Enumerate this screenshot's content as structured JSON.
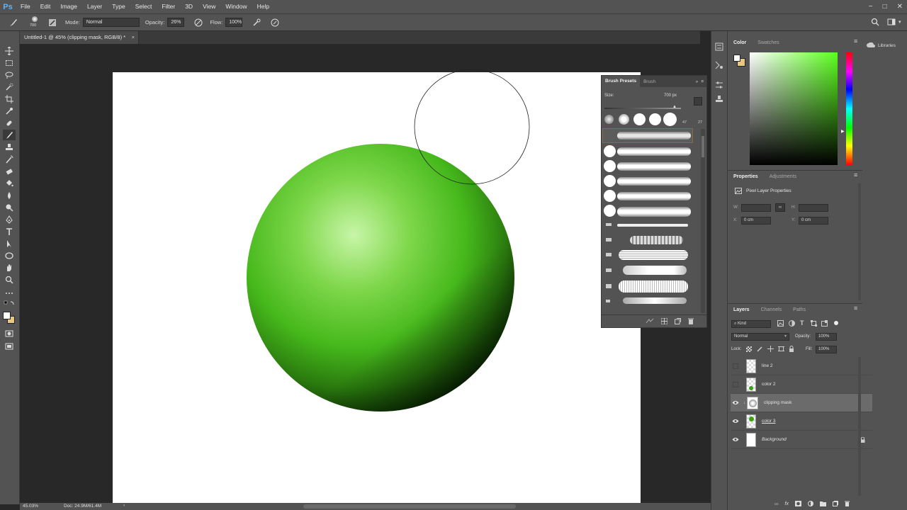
{
  "app": {
    "logo": "Ps"
  },
  "menu": [
    "File",
    "Edit",
    "Image",
    "Layer",
    "Type",
    "Select",
    "Filter",
    "3D",
    "View",
    "Window",
    "Help"
  ],
  "window_controls": [
    "−",
    "□",
    "✕"
  ],
  "options": {
    "brush_size": "700",
    "mode_label": "Mode:",
    "mode_value": "Normal",
    "opacity_label": "Opacity:",
    "opacity_value": "26%",
    "flow_label": "Flow:",
    "flow_value": "100%"
  },
  "document": {
    "tab_title": "Untitled-1 @ 45% (clipping mask, RGB/8) *",
    "close": "×"
  },
  "status": {
    "zoom": "45.03%",
    "doc": "Doc: 24.9M/61.4M"
  },
  "brush_panel": {
    "tabs": [
      "Brush Presets",
      "Brush"
    ],
    "size_label": "Size:",
    "size_value": "700 px",
    "preset_numbers": [
      "47",
      "27"
    ]
  },
  "color_panel": {
    "tabs": [
      "Color",
      "Swatches"
    ],
    "libraries": "Libraries"
  },
  "properties_panel": {
    "tabs": [
      "Properties",
      "Adjustments"
    ],
    "title": "Pixel Layer Properties",
    "w_label": "W:",
    "h_label": "H:",
    "x_label": "X:",
    "x_value": "0 cm",
    "y_label": "Y:",
    "y_value": "0 cm"
  },
  "layers_panel": {
    "tabs": [
      "Layers",
      "Channels",
      "Paths"
    ],
    "filter": "Kind",
    "blend_mode": "Normal",
    "opacity_label": "Opacity:",
    "opacity_value": "100%",
    "lock_label": "Lock:",
    "fill_label": "Fill:",
    "fill_value": "100%",
    "layers": [
      {
        "name": "line 2",
        "visible": false
      },
      {
        "name": "color 2",
        "visible": false
      },
      {
        "name": "clipping mask",
        "visible": true,
        "selected": true
      },
      {
        "name": "color 3",
        "visible": true
      },
      {
        "name": "Background",
        "visible": true,
        "locked": true
      }
    ]
  },
  "colors": {
    "accent": "#5bb5ff",
    "sphere_light": "#c8f5a8",
    "sphere_mid": "#46b81c",
    "sphere_dark": "#0b2e03"
  }
}
